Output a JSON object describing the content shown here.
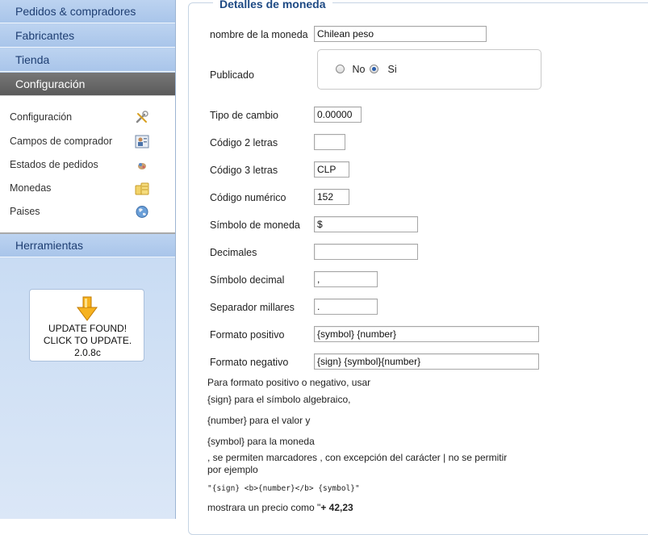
{
  "sidebar": {
    "nav": [
      {
        "label": "Pedidos & compradores"
      },
      {
        "label": "Fabricantes"
      },
      {
        "label": "Tienda"
      },
      {
        "label": "Configuración",
        "active": true
      }
    ],
    "submenu": [
      {
        "label": "Configuración",
        "icon": "tools-icon"
      },
      {
        "label": "Campos de comprador",
        "icon": "user-fields-icon"
      },
      {
        "label": "Estados de pedidos",
        "icon": "order-status-icon"
      },
      {
        "label": "Monedas",
        "icon": "coins-icon"
      },
      {
        "label": "Paises",
        "icon": "globe-icon"
      }
    ],
    "tools": {
      "label": "Herramientas"
    },
    "update": {
      "line1": "UPDATE FOUND!",
      "line2": "CLICK TO UPDATE.",
      "version": "2.0.8c"
    }
  },
  "form": {
    "legend": "Detalles de moneda",
    "nombre": {
      "label": "nombre de la moneda",
      "value": "Chilean peso"
    },
    "publicado": {
      "label": "Publicado",
      "no_label": "No",
      "si_label": "Si",
      "selected": "Si"
    },
    "tipo_cambio": {
      "label": "Tipo de cambio",
      "value": "0.00000"
    },
    "codigo2": {
      "label": "Código 2 letras",
      "value": ""
    },
    "codigo3": {
      "label": "Código 3 letras",
      "value": "CLP"
    },
    "codigo_num": {
      "label": "Código numérico",
      "value": "152"
    },
    "simbolo": {
      "label": "Símbolo de moneda",
      "value": "$"
    },
    "decimales": {
      "label": "Decimales",
      "value": ""
    },
    "simbolo_decimal": {
      "label": "Símbolo decimal",
      "value": ","
    },
    "separador": {
      "label": "Separador millares",
      "value": "."
    },
    "formato_pos": {
      "label": "Formato positivo",
      "value": "{symbol} {number}"
    },
    "formato_neg": {
      "label": "Formato negativo",
      "value": "{sign} {symbol}{number}"
    }
  },
  "help": {
    "intro": "Para formato positivo o negativo, usar",
    "sign": " {sign} para el símbolo algebraico,",
    "number": " {number} para el valor y",
    "symbol": " {symbol} para la moneda",
    "note1": ", se permiten marcadores , con excepción del carácter | no se permitir",
    "note2": "por ejemplo",
    "example": "\"{sign} <b>{number}</b> {symbol}\"",
    "result_prefix": "mostrara un precio como \"",
    "result_value": "+ 42,23"
  },
  "colors": {
    "accent": "#1e4a84",
    "nav_bg": "#a9c5ea",
    "nav_active": "#5a5a5a"
  }
}
